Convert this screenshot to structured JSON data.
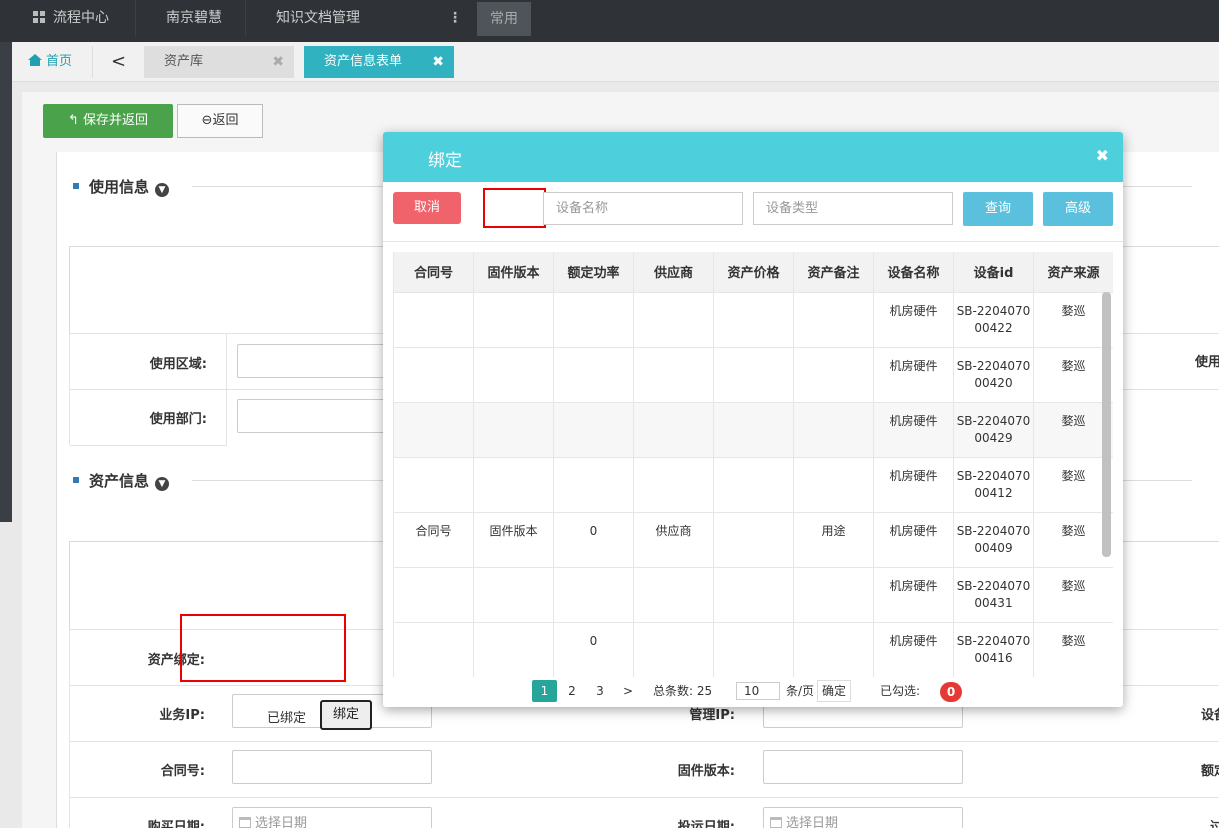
{
  "topbar": {
    "flow_center": "流程中心",
    "company": "南京碧慧",
    "knowledge": "知识文档管理",
    "more": "⋮",
    "common": "常用"
  },
  "tabs": {
    "home": "首页",
    "back": "<",
    "asset_lib": "资产库",
    "asset_form": "资产信息表单",
    "close": "✖"
  },
  "toolbar": {
    "save_return": "保存并返回",
    "return": "返回"
  },
  "form": {
    "usage_section": "使用信息",
    "usage_area_label": "使用区域:",
    "usage_dept_label": "使用部门:",
    "usage_right_label": "使用",
    "asset_section": "资产信息",
    "asset_bind_label": "资产绑定:",
    "bound_status": "已绑定",
    "bind_button": "绑定",
    "biz_ip_label": "业务IP:",
    "mgmt_ip_label": "管理IP:",
    "device_right_label": "设备",
    "contract_label": "合同号:",
    "firmware_label": "固件版本:",
    "rated_right_label": "额定",
    "buy_date_label": "购买日期:",
    "buy_date_placeholder": "选择日期",
    "ship_date_label": "投运日期:",
    "ship_date_placeholder": "选择日期",
    "over_right_label": "过"
  },
  "modal": {
    "title": "绑定",
    "close": "✖",
    "cancel": "取消",
    "device_name_placeholder": "设备名称",
    "device_type_placeholder": "设备类型",
    "query": "查询",
    "advanced": "高级",
    "columns": [
      "合同号",
      "固件版本",
      "额定功率",
      "供应商",
      "资产价格",
      "资产备注",
      "设备名称",
      "设备id",
      "资产来源"
    ],
    "rows": [
      [
        "",
        "",
        "",
        "",
        "",
        "",
        "机房硬件",
        "SB-220407000422",
        "婺巡"
      ],
      [
        "",
        "",
        "",
        "",
        "",
        "",
        "机房硬件",
        "SB-220407000420",
        "婺巡"
      ],
      [
        "",
        "",
        "",
        "",
        "",
        "",
        "机房硬件",
        "SB-220407000429",
        "婺巡"
      ],
      [
        "",
        "",
        "",
        "",
        "",
        "",
        "机房硬件",
        "SB-220407000412",
        "婺巡"
      ],
      [
        "合同号",
        "固件版本",
        "0",
        "供应商",
        "",
        "用途",
        "机房硬件",
        "SB-220407000409",
        "婺巡"
      ],
      [
        "",
        "",
        "",
        "",
        "",
        "",
        "机房硬件",
        "SB-220407000431",
        "婺巡"
      ],
      [
        "",
        "",
        "0",
        "",
        "",
        "",
        "机房硬件",
        "SB-220407000416",
        "婺巡"
      ]
    ],
    "pager": {
      "pages": [
        "1",
        "2",
        "3"
      ],
      "next": ">",
      "total": "总条数: 25",
      "page_size": "10",
      "per_page": "条/页",
      "confirm": "确定",
      "selected_label": "已勾选:",
      "selected_count": "0"
    }
  }
}
